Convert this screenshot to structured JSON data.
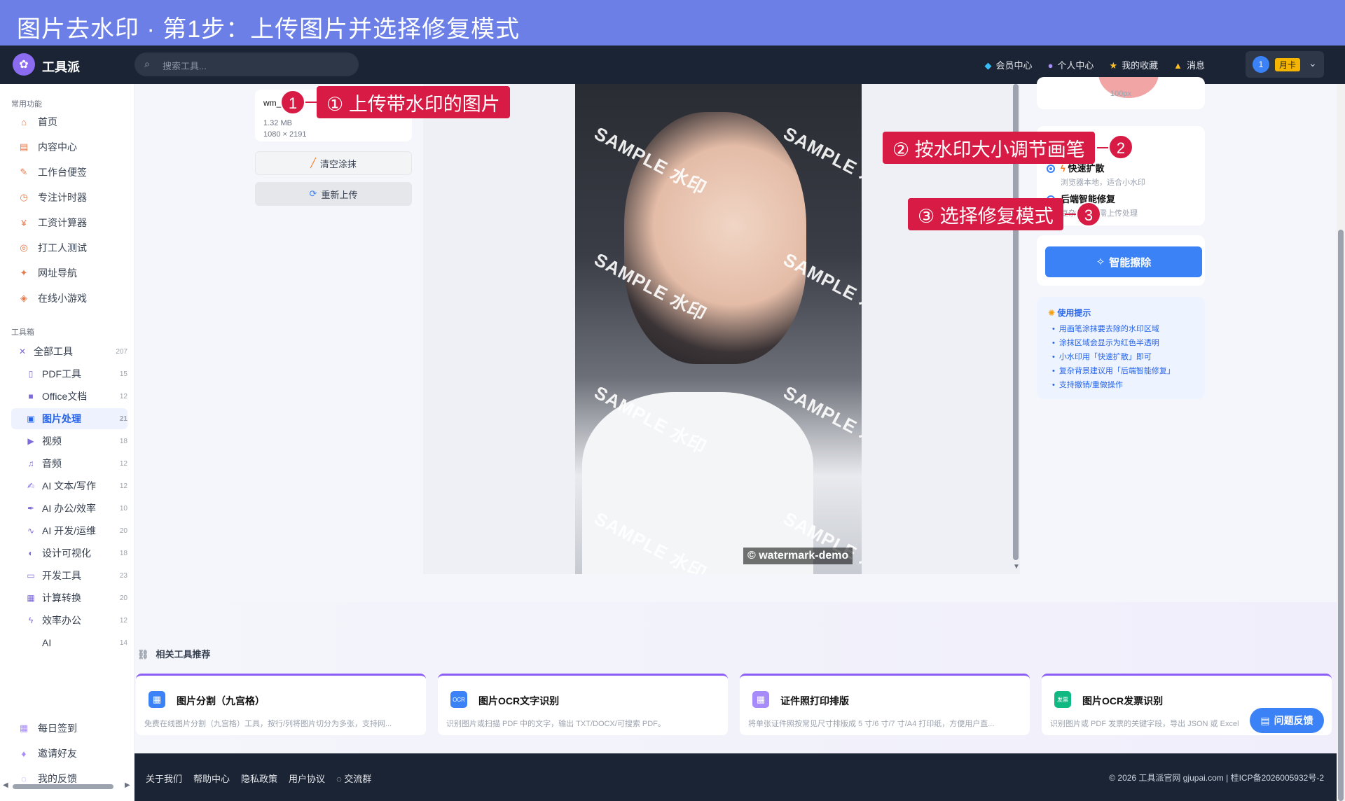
{
  "banner": {
    "title": "图片去水印 · 第1步：上传图片并选择修复模式"
  },
  "appbar": {
    "brand": "工具派",
    "search_placeholder": "搜索工具...",
    "links": [
      {
        "icon": "gem-icon",
        "glyph": "◆",
        "color": "#38bdf8",
        "label": "会员中心"
      },
      {
        "icon": "user-icon",
        "glyph": "●",
        "color": "#a78bfa",
        "label": "个人中心"
      },
      {
        "icon": "star-icon",
        "glyph": "★",
        "color": "#fbbf24",
        "label": "我的收藏"
      },
      {
        "icon": "bell-icon",
        "glyph": "▲",
        "color": "#fbbf24",
        "label": "消息"
      }
    ],
    "user": {
      "badge": "1",
      "tier": "月卡"
    }
  },
  "sidebar": {
    "common_title": "常用功能",
    "common": [
      {
        "label": "首页",
        "icon": "home-icon",
        "glyph": "⌂"
      },
      {
        "label": "内容中心",
        "icon": "newspaper-icon",
        "glyph": "▤"
      },
      {
        "label": "工作台便签",
        "icon": "memo-icon",
        "glyph": "✎"
      },
      {
        "label": "专注计时器",
        "icon": "timer-icon",
        "glyph": "◷"
      },
      {
        "label": "工资计算器",
        "icon": "money-bag-icon",
        "glyph": "¥"
      },
      {
        "label": "打工人测试",
        "icon": "target-icon",
        "glyph": "◎"
      },
      {
        "label": "网址导航",
        "icon": "compass-icon",
        "glyph": "✦"
      },
      {
        "label": "在线小游戏",
        "icon": "gamepad-icon",
        "glyph": "◈"
      }
    ],
    "tools_title": "工具箱",
    "tools": [
      {
        "label": "全部工具",
        "count": "207",
        "icon": "tools-icon",
        "glyph": "✕",
        "kind": "all"
      },
      {
        "label": "PDF工具",
        "count": "15",
        "icon": "pdf-icon",
        "glyph": "▯"
      },
      {
        "label": "Office文档",
        "count": "12",
        "icon": "office-icon",
        "glyph": "■"
      },
      {
        "label": "图片处理",
        "count": "21",
        "icon": "image-icon",
        "glyph": "▣",
        "active": true
      },
      {
        "label": "视频",
        "count": "18",
        "icon": "video-icon",
        "glyph": "▶"
      },
      {
        "label": "音频",
        "count": "12",
        "icon": "music-icon",
        "glyph": "♫"
      },
      {
        "label": "AI 文本/写作",
        "count": "12",
        "icon": "ai-writing-icon",
        "glyph": "✍"
      },
      {
        "label": "AI 办公/效率",
        "count": "10",
        "icon": "ai-office-icon",
        "glyph": "✒"
      },
      {
        "label": "AI 开发/运维",
        "count": "20",
        "icon": "ai-dev-icon",
        "glyph": "∿"
      },
      {
        "label": "设计可视化",
        "count": "18",
        "icon": "palette-icon",
        "glyph": "◐"
      },
      {
        "label": "开发工具",
        "count": "23",
        "icon": "monitor-icon",
        "glyph": "▭"
      },
      {
        "label": "计算转换",
        "count": "20",
        "icon": "calculator-icon",
        "glyph": "▦"
      },
      {
        "label": "效率办公",
        "count": "12",
        "icon": "lightning-icon",
        "glyph": "ϟ"
      },
      {
        "label": "AI",
        "count": "14",
        "icon": "ai-icon",
        "glyph": ""
      }
    ],
    "bottom": [
      {
        "label": "每日签到",
        "icon": "calendar-icon",
        "glyph": "▦"
      },
      {
        "label": "邀请好友",
        "icon": "gift-icon",
        "glyph": "♦"
      },
      {
        "label": "我的反馈",
        "icon": "chat-icon",
        "glyph": "◌"
      }
    ]
  },
  "upload": {
    "file_name": "wm_...",
    "file_size": "1.32 MB",
    "file_dim": "1080 × 2191",
    "clear_label": "清空涂抹",
    "reupload_label": "重新上传"
  },
  "canvas": {
    "watermark_text": "SAMPLE 水印",
    "copyright": "© watermark-demo"
  },
  "right_panel": {
    "brush_size": "100px",
    "modes": [
      {
        "title": "快速扩散",
        "desc": "浏览器本地，适合小水印",
        "selected": true
      },
      {
        "title": "后端智能修复",
        "desc": "复杂背景，需上传处理",
        "selected": false
      }
    ],
    "erase_label": "智能擦除",
    "tips_title": "使用提示",
    "tips": [
      "用画笔涂抹要去除的水印区域",
      "涂抹区域会显示为红色半透明",
      "小水印用「快速扩散」即可",
      "复杂背景建议用「后端智能修复」",
      "支持撤销/重做操作"
    ]
  },
  "related": {
    "title": "相关工具推荐",
    "cards": [
      {
        "title": "图片分割（九宫格）",
        "desc": "免费在线图片分割（九宫格）工具，按行/列将图片切分为多张，支持网...",
        "icon": "grid-icon",
        "glyph": "▦",
        "color": "#3b82f6"
      },
      {
        "title": "图片OCR文字识别",
        "desc": "识别图片或扫描 PDF 中的文字，输出 TXT/DOCX/可搜索 PDF。",
        "icon": "ocr-icon",
        "glyph": "OCR",
        "color": "#3b82f6"
      },
      {
        "title": "证件照打印排版",
        "desc": "将单张证件照按常见尺寸排版成 5 寸/6 寸/7 寸/A4 打印纸，方便用户直...",
        "icon": "id-photo-icon",
        "glyph": "▦",
        "color": "#a78bfa"
      },
      {
        "title": "图片OCR发票识别",
        "desc": "识别图片或 PDF 发票的关键字段，导出 JSON 或 Excel",
        "icon": "invoice-icon",
        "glyph": "发票",
        "color": "#10b981"
      }
    ]
  },
  "footer": {
    "links": [
      "关于我们",
      "帮助中心",
      "隐私政策",
      "用户协议",
      "交流群"
    ],
    "copyright": "© 2026 工具派官网 gjupai.com | 桂ICP备2026005932号-2"
  },
  "feedback_button": "问题反馈",
  "annotations": [
    {
      "num": "1",
      "text": "① 上传带水印的图片"
    },
    {
      "num": "2",
      "text": "② 按水印大小调节画笔"
    },
    {
      "num": "3",
      "text": "③ 选择修复模式"
    }
  ],
  "colors": {
    "accent": "#3b82f6",
    "annotation": "#d81b44",
    "banner": "#6b7fe6",
    "header": "#1b2434"
  }
}
